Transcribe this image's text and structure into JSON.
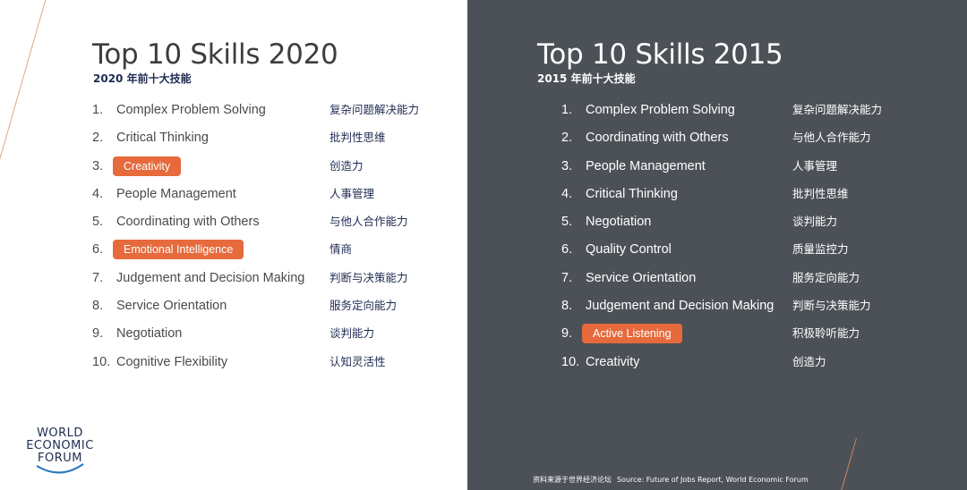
{
  "left": {
    "title": "Top 10 Skills 2020",
    "subtitle": "2020 年前十大技能",
    "items": [
      {
        "num": "1.",
        "skill": "Complex Problem Solving",
        "zh": "复杂问题解决能力",
        "highlight": false
      },
      {
        "num": "2.",
        "skill": "Critical Thinking",
        "zh": "批判性思维",
        "highlight": false
      },
      {
        "num": "3.",
        "skill": "Creativity",
        "zh": "创造力",
        "highlight": true
      },
      {
        "num": "4.",
        "skill": "People Management",
        "zh": "人事管理",
        "highlight": false
      },
      {
        "num": "5.",
        "skill": "Coordinating with Others",
        "zh": "与他人合作能力",
        "highlight": false
      },
      {
        "num": "6.",
        "skill": "Emotional Intelligence",
        "zh": "情商",
        "highlight": true
      },
      {
        "num": "7.",
        "skill": "Judgement and Decision Making",
        "zh": "判断与决策能力",
        "highlight": false
      },
      {
        "num": "8.",
        "skill": "Service Orientation",
        "zh": "服务定向能力",
        "highlight": false
      },
      {
        "num": "9.",
        "skill": "Negotiation",
        "zh": "谈判能力",
        "highlight": false
      },
      {
        "num": "10.",
        "skill": "Cognitive Flexibility",
        "zh": "认知灵活性",
        "highlight": false
      }
    ]
  },
  "right": {
    "title": "Top 10 Skills 2015",
    "subtitle": "2015 年前十大技能",
    "items": [
      {
        "num": "1.",
        "skill": "Complex Problem Solving",
        "zh": "复杂问题解决能力",
        "highlight": false
      },
      {
        "num": "2.",
        "skill": "Coordinating with Others",
        "zh": "与他人合作能力",
        "highlight": false
      },
      {
        "num": "3.",
        "skill": "People Management",
        "zh": "人事管理",
        "highlight": false
      },
      {
        "num": "4.",
        "skill": "Critical Thinking",
        "zh": "批判性思维",
        "highlight": false
      },
      {
        "num": "5.",
        "skill": "Negotiation",
        "zh": "谈判能力",
        "highlight": false
      },
      {
        "num": "6.",
        "skill": "Quality Control",
        "zh": "质量监控力",
        "highlight": false
      },
      {
        "num": "7.",
        "skill": "Service Orientation",
        "zh": "服务定向能力",
        "highlight": false
      },
      {
        "num": "8.",
        "skill": "Judgement and Decision Making",
        "zh": "判断与决策能力",
        "highlight": false
      },
      {
        "num": "9.",
        "skill": "Active Listening",
        "zh": "积极聆听能力",
        "highlight": true
      },
      {
        "num": "10.",
        "skill": "Creativity",
        "zh": "创造力",
        "highlight": false
      }
    ]
  },
  "logo": {
    "line1": "WORLD",
    "line2": "ECONOMIC",
    "line3": "FORUM",
    "icon": "wef-arc-icon"
  },
  "source": {
    "zh": "资料来源于世界经济论坛",
    "en": "Source:  Future of Jobs Report, World Economic Forum"
  },
  "colors": {
    "highlight": "#e66a3c",
    "right_panel": "#4b5157",
    "navy": "#1f2b52"
  }
}
